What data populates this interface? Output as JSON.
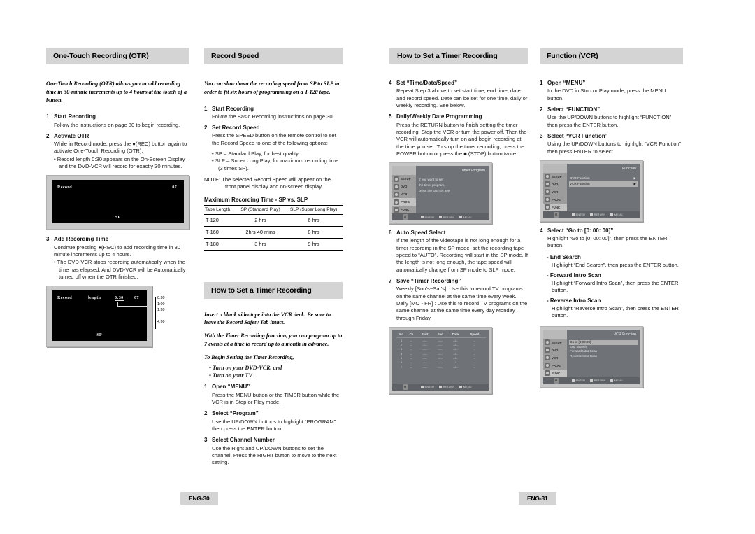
{
  "document": {
    "type": "dvd-vcr-user-manual-spread",
    "left_page_number": "ENG-30",
    "right_page_number": "ENG-31"
  },
  "col1": {
    "header": "One-Touch Recording (OTR)",
    "intro": "One-Touch Recording (OTR) allows you to add recording time in 30-minute increments up to 4 hours at the touch of a button.",
    "steps": [
      {
        "num": "1",
        "title": "Start Recording",
        "text": "Follow the instructions on page 30 to begin recording.",
        "bullets": []
      },
      {
        "num": "2",
        "title": "Activate OTR",
        "text": "While in Record mode, press the ●(REC) button again to activate One-Touch Recording (OTR).",
        "bullets": [
          "• Record length 0:30 appears on the On-Screen Display and the DVD-VCR will record for exactly 30 minutes."
        ]
      },
      {
        "num": "3",
        "title": "Add Recording Time",
        "text": "Continue pressing ●(REC) to add recording time in 30 minute increments up to 4 hours.",
        "bullets": [
          "• The DVD-VCR stops recording automatically when the time has elapsed.  And  DVD-VCR will be Automatically turned off when  the OTR finished."
        ]
      }
    ],
    "tv1": {
      "label_record": "Record",
      "label_channel": "07",
      "label_speed": "SP"
    },
    "tv2": {
      "label_record": "Record",
      "label_length": "length",
      "label_time": "0:30",
      "label_channel": "07",
      "label_speed": "SP",
      "scale": [
        "0:30",
        "1:00",
        "1:30",
        "⋮",
        "4:30"
      ]
    }
  },
  "col2": {
    "header": "Record Speed",
    "intro": "You can slow down the recording speed from SP to SLP in order to fit six hours of programming on a T-120 tape.",
    "steps": [
      {
        "num": "1",
        "title": "Start Recording",
        "text": "Follow the Basic Recording instructions on page 30.",
        "bullets": []
      },
      {
        "num": "2",
        "title": "Set Record Speed",
        "text": "Press the SPEED button on the remote control to set the Record Speed to one of the following options:",
        "bullets": [
          "• SP –   Standard Play, for best quality.",
          "• SLP – Super Long Play, for maximum recording time (3 times SP)."
        ]
      }
    ],
    "note": "NOTE: The selected Record Speed will appear on the front panel display and on-screen display.",
    "table": {
      "title": "Maximum Recording Time - SP vs. SLP",
      "headers": [
        "Tape Length",
        "SP (Standard Play)",
        "SLP (Super Long Play)"
      ],
      "rows": [
        [
          "T-120",
          "2 hrs",
          "6 hrs"
        ],
        [
          "T-160",
          "2hrs 40 mins",
          "8 hrs"
        ],
        [
          "T-180",
          "3 hrs",
          "9 hrs"
        ]
      ]
    },
    "header2": "How to Set a Timer Recording",
    "intro2a": "Insert a blank videotape into the VCR deck. Be sure to leave the Record Safety Tab intact.",
    "intro2b": "With the Timer Recording function, you can program up to 7 events at a time to record up to a month in advance.",
    "intro2c": "To Begin Setting the Timer Recording,",
    "intro_bullets": [
      "• Turn on your DVD-VCR, and",
      "• Turn on your TV."
    ],
    "steps2": [
      {
        "num": "1",
        "title": "Open “MENU”",
        "text": "Press the MENU button or the TIMER button while the VCR is in Stop or Play mode."
      },
      {
        "num": "2",
        "title": "Select “Program”",
        "text": "Use the UP/DOWN buttons to highlight “PROGRAM” then press the ENTER button."
      },
      {
        "num": "3",
        "title": "Select Channel Number",
        "text": "Use the Right and UP/DOWN buttons to set the channel. Press the RIGHT button to move to the next setting."
      }
    ]
  },
  "col3": {
    "header": "How to Set a Timer Recording",
    "steps": [
      {
        "num": "4",
        "title": "Set “Time/Date/Speed”",
        "text": "Repeat Step 3 above to set start time, end time, date and record speed. Date can be set for one time, daily or weekly recording. See below."
      },
      {
        "num": "5",
        "title": "Daily/Weekly Date Programming",
        "text": "Press the RETURN button to finish setting the timer recording. Stop the VCR or turn the power off. Then the VCR will automatically turn on and begin recording at the time you set. To stop the timer recording, press the POWER button or press the ■ (STOP) button twice."
      },
      {
        "num": "6",
        "title": "Auto Speed Select",
        "text": "If the length of the videotape is not long enough for a timer recording in the SP mode, set the recording tape speed to “AUTO”. Recording will start in the SP mode. If the length is not long enough, the tape speed will automatically change from SP mode to SLP mode."
      },
      {
        "num": "7",
        "title": "Save “Timer Recording”",
        "text": "Weekly [Sun’s~Sat’s]: Use this to record TV programs on the same channel at the same time every week. Daily [MO - FR] : Use this to record TV programs on the same channel at the same time every day Monday through Friday."
      }
    ],
    "osd1": {
      "title": "Timer Program",
      "sidebar": [
        "SETUP",
        "DVD",
        "VCR",
        "PROG",
        "FUNC"
      ],
      "selected": "PROG",
      "lines": [
        "If you want to set",
        "the timer program,",
        "press the ENTER key"
      ],
      "footer": [
        "ENTER",
        "RETURN",
        "MENU"
      ]
    },
    "osd2": {
      "headers": [
        "No",
        "Ch",
        "Start",
        "End",
        "Date",
        "Speed"
      ],
      "rows": [
        [
          "1",
          "--",
          "--:--",
          "--:--",
          "--/--",
          "--"
        ],
        [
          "2",
          "--",
          "--:--",
          "--:--",
          "--/--",
          "--"
        ],
        [
          "3",
          "--",
          "--:--",
          "--:--",
          "--/--",
          "--"
        ],
        [
          "4",
          "--",
          "--:--",
          "--:--",
          "--/--",
          "--"
        ],
        [
          "5",
          "--",
          "--:--",
          "--:--",
          "--/--",
          "--"
        ],
        [
          "6",
          "--",
          "--:--",
          "--:--",
          "--/--",
          "--"
        ],
        [
          "7",
          "--",
          "--:--",
          "--:--",
          "--/--",
          "--"
        ]
      ],
      "footer": [
        "ENTER",
        "RETURN",
        "MENU"
      ]
    }
  },
  "col4": {
    "header": "Function (VCR)",
    "steps": [
      {
        "num": "1",
        "title": "Open “MENU”",
        "text": "In the DVD in Stop or Play mode, press the MENU button."
      },
      {
        "num": "2",
        "title": "Select “FUNCTION”",
        "text": "Use the UP/DOWN buttons to highlight “FUNCTION” then press the ENTER button."
      },
      {
        "num": "3",
        "title": "Select “VCR Function”",
        "text": "Using the UP/DOWN buttons to highlight “VCR Function”  then press ENTER to select."
      }
    ],
    "osd1": {
      "title": "Function",
      "sidebar": [
        "SETUP",
        "DVD",
        "VCR",
        "PROG",
        "FUNC"
      ],
      "selected": "FUNC",
      "items": [
        "DVD Function",
        "VCR Function"
      ],
      "highlighted": "VCR Function",
      "footer": [
        "ENTER",
        "RETURN",
        "MENU"
      ]
    },
    "step4": {
      "num": "4",
      "title": "Select “Go to [0: 00: 00]”",
      "text": "Highlight “Go to [0: 00: 00]”, then press the ENTER button."
    },
    "subitems": [
      {
        "title": "- End Search",
        "text": "Highlight “End Search”, then press the ENTER button."
      },
      {
        "title": "- Forward Intro Scan",
        "text": "Highlight “Forward Intro Scan”, then press the ENTER button."
      },
      {
        "title": "- Reverse Intro Scan",
        "text": "Highlight “Reverse Intro Scan”, then press the ENTER button."
      }
    ],
    "osd2": {
      "title": "VCR Function",
      "sidebar": [
        "SETUP",
        "DVD",
        "VCR",
        "PROG",
        "FUNC"
      ],
      "selected": "FUNC",
      "items": [
        "Go to [0:00:00]",
        "End Search",
        "Forward Intro Scan",
        "Reverse Intro Scan"
      ],
      "highlighted": "Go to [0:00:00]",
      "footer": [
        "ENTER",
        "RETURN",
        "MENU"
      ]
    }
  }
}
